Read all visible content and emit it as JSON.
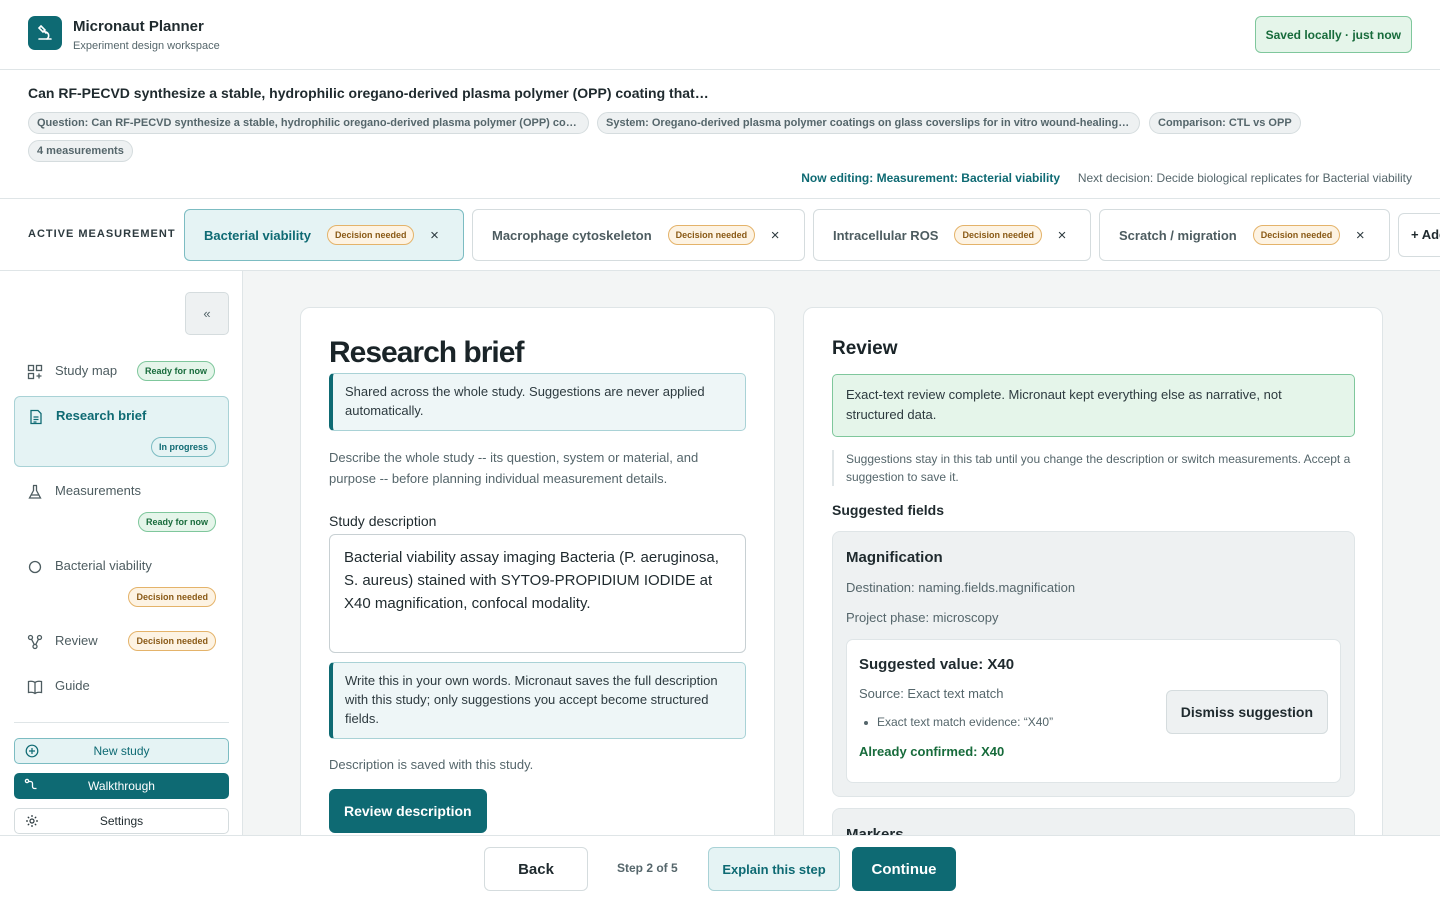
{
  "app": {
    "name": "Micronaut Planner",
    "subtitle": "Experiment design workspace",
    "save_status": "Saved locally · just now"
  },
  "study": {
    "title": "Can RF-PECVD synthesize a stable, hydrophilic oregano-derived plasma polymer (OPP) coating that…",
    "chips": [
      "Question: Can RF-PECVD synthesize a stable, hydrophilic oregano-derived plasma polymer (OPP) co…",
      "System: Oregano-derived plasma polymer coatings on glass coverslips for in vitro wound-healing…",
      "Comparison: CTL vs OPP",
      "4 measurements"
    ],
    "now_editing": "Now editing: Measurement: Bacterial viability",
    "next_decision": "Next decision: Decide biological replicates for Bacterial viability"
  },
  "measurements": {
    "label": "ACTIVE MEASUREMENT",
    "tabs": [
      {
        "label": "Bacterial viability",
        "badge": "Decision needed"
      },
      {
        "label": "Macrophage cytoskeleton",
        "badge": "Decision needed"
      },
      {
        "label": "Intracellular ROS",
        "badge": "Decision needed"
      },
      {
        "label": "Scratch / migration",
        "badge": "Decision needed"
      }
    ],
    "add_label": "+ Add"
  },
  "sidebar": {
    "collapse": "«",
    "items": [
      {
        "label": "Study map",
        "badge": "Ready for now",
        "icon": "grid-icon"
      },
      {
        "label": "Research brief",
        "badge": "In progress",
        "icon": "document-icon"
      },
      {
        "label": "Measurements",
        "badge": "Ready for now",
        "icon": "flask-icon"
      },
      {
        "label": "Bacterial viability",
        "badge": "Decision needed",
        "icon": "circle-icon"
      },
      {
        "label": "Review",
        "badge": "Decision needed",
        "icon": "branch-icon"
      },
      {
        "label": "Guide",
        "icon": "book-icon"
      }
    ],
    "new_study": "New study",
    "walkthrough": "Walkthrough",
    "settings": "Settings"
  },
  "brief": {
    "title": "Research brief",
    "callout": "Shared across the whole study. Suggestions are never applied automatically.",
    "description": "Describe the whole study -- its question, system or material, and purpose -- before planning individual measurement details.",
    "field_label": "Study description",
    "field_value": "Bacterial viability assay imaging Bacteria (P. aeruginosa, S. aureus) stained with SYTO9-PROPIDIUM IODIDE at X40 magnification, confocal modality.",
    "hint": "Write this in your own words. Micronaut saves the full description with this study; only suggestions you accept become structured fields.",
    "saved_note": "Description is saved with this study.",
    "review_button": "Review description"
  },
  "review": {
    "title": "Review",
    "success": "Exact-text review complete. Micronaut kept everything else as narrative, not structured data.",
    "info": "Suggestions stay in this tab until you change the description or switch measurements. Accept a suggestion to save it.",
    "suggested_heading": "Suggested fields",
    "field": {
      "title": "Magnification",
      "destination": "Destination: naming.fields.magnification",
      "phase": "Project phase: microscopy",
      "suggested_value": "Suggested value: X40",
      "source": "Source: Exact text match",
      "evidence": "Exact text match evidence: “X40”",
      "confirmed": "Already confirmed: X40",
      "dismiss": "Dismiss suggestion"
    },
    "next_field_title": "Markers"
  },
  "footer": {
    "back": "Back",
    "step": "Step 2 of 5",
    "explain": "Explain this step",
    "continue": "Continue"
  }
}
